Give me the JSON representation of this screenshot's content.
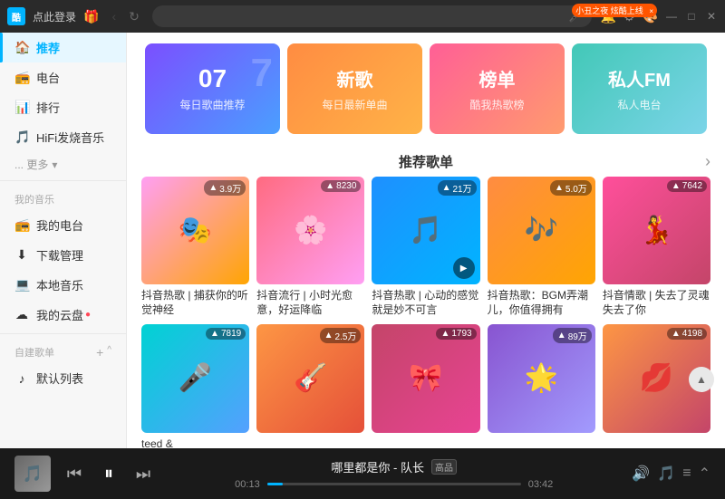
{
  "titlebar": {
    "logo": "酷",
    "login": "点此登录",
    "vip": "🎁",
    "back": "‹",
    "forward": "›",
    "refresh": "↻",
    "search_placeholder": "",
    "mic": "🎤",
    "notification": "小丑之夜 炫酷上线",
    "notification_close": "×",
    "bell": "🔔",
    "settings": "⚙",
    "skin": "🎨",
    "minimize": "—",
    "maximize": "□",
    "close": "✕"
  },
  "sidebar": {
    "items": [
      {
        "id": "recommend",
        "icon": "🏠",
        "label": "推荐",
        "active": true
      },
      {
        "id": "radio",
        "icon": "📻",
        "label": "电台",
        "active": false
      },
      {
        "id": "chart",
        "icon": "📊",
        "label": "排行",
        "active": false
      },
      {
        "id": "hifi",
        "icon": "🎵",
        "label": "HiFi发烧音乐",
        "active": false
      },
      {
        "id": "more",
        "icon": "",
        "label": "... 更多",
        "active": false
      }
    ],
    "my_music_title": "我的音乐",
    "my_items": [
      {
        "id": "my-radio",
        "icon": "📻",
        "label": "我的电台"
      },
      {
        "id": "download",
        "icon": "⬇",
        "label": "下载管理"
      },
      {
        "id": "local",
        "icon": "💻",
        "label": "本地音乐"
      },
      {
        "id": "cloud",
        "icon": "☁",
        "label": "我的云盘"
      }
    ],
    "playlist_title": "自建歌单",
    "add_btn": "+",
    "toggle": "^",
    "default_list": "默认列表"
  },
  "hero": {
    "cards": [
      {
        "id": "daily",
        "num": "07",
        "title": "",
        "subtitle": "每日歌曲推荐",
        "overlay": "7"
      },
      {
        "id": "new",
        "title": "新歌",
        "subtitle": "每日最新单曲"
      },
      {
        "id": "chart",
        "title": "榜单",
        "subtitle": "酷我热歌榜"
      },
      {
        "id": "fm",
        "title": "私人FM",
        "subtitle": "私人电台"
      }
    ]
  },
  "recommend": {
    "title": "推荐歌单",
    "more_icon": "›",
    "playlists_row1": [
      {
        "id": "p1",
        "count": "3.9万",
        "name": "抖音热歌 | 捕获你的听觉神经",
        "thumb_class": "thumb-1"
      },
      {
        "id": "p2",
        "count": "8230",
        "name": "抖音流行 | 小时光愈意，好运降临",
        "thumb_class": "thumb-2"
      },
      {
        "id": "p3",
        "count": "21万",
        "name": "抖音热歌 | 心动的感觉就是妙不可言",
        "thumb_class": "thumb-3",
        "has_play": true
      },
      {
        "id": "p4",
        "count": "5.0万",
        "name": "抖音热歌：BGM弄潮儿，你值得拥有",
        "thumb_class": "thumb-4"
      },
      {
        "id": "p5",
        "count": "7642",
        "name": "抖音情歌 | 失去了灵魂失去了你",
        "thumb_class": "thumb-5"
      }
    ],
    "playlists_row2": [
      {
        "id": "p6",
        "count": "7819",
        "name": "teed &",
        "thumb_class": "thumb-6"
      },
      {
        "id": "p7",
        "count": "2.5万",
        "name": "",
        "thumb_class": "thumb-7"
      },
      {
        "id": "p8",
        "count": "1793",
        "name": "",
        "thumb_class": "thumb-8"
      },
      {
        "id": "p9",
        "count": "89万",
        "name": "",
        "thumb_class": "thumb-9"
      },
      {
        "id": "p10",
        "count": "4198",
        "name": "",
        "thumb_class": "thumb-10"
      }
    ]
  },
  "player": {
    "prev": "⏮",
    "play": "⏸",
    "next": "⏭",
    "title": "哪里都是你 - 队长",
    "current_time": "00:13",
    "total_time": "03:42",
    "quality": "高品",
    "progress_pct": 6,
    "volume_icon": "🔊",
    "sound_icon": "🎵",
    "playlist_icon": "≡",
    "expand_icon": "⌃"
  }
}
